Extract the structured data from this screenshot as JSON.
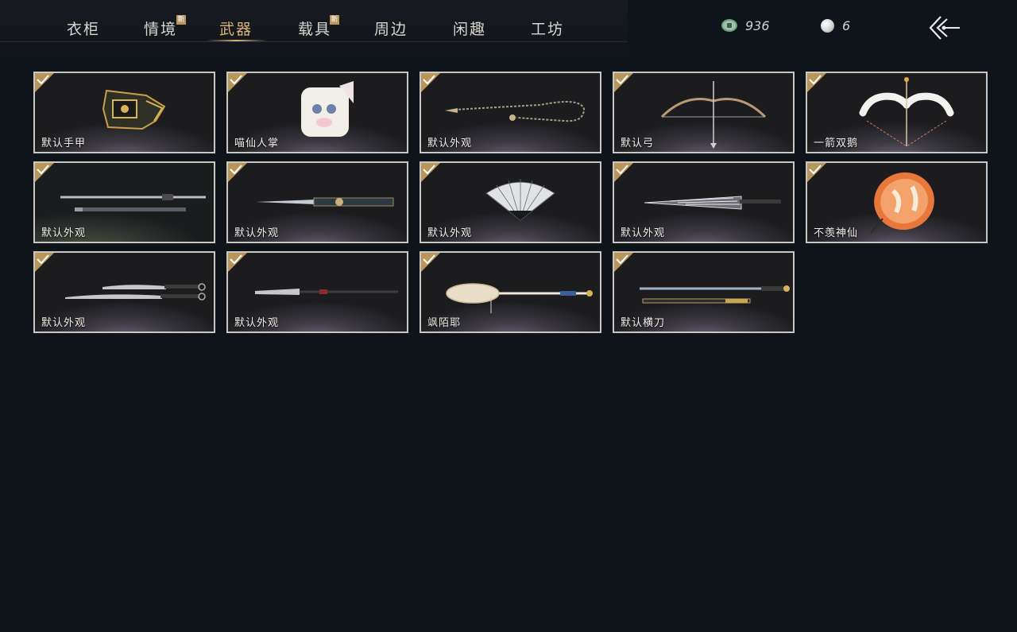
{
  "nav": {
    "tabs": [
      {
        "label": "衣柜",
        "new": false
      },
      {
        "label": "情境",
        "new": true
      },
      {
        "label": "武器",
        "new": false,
        "active": true
      },
      {
        "label": "载具",
        "new": true
      },
      {
        "label": "周边",
        "new": false
      },
      {
        "label": "闲趣",
        "new": false
      },
      {
        "label": "工坊",
        "new": false
      }
    ],
    "new_badge_label": "新"
  },
  "currency": {
    "jade_coin": "936",
    "pearl": "6"
  },
  "items": [
    {
      "name": "默认手甲",
      "owned": true,
      "icon": "gauntlet-icon"
    },
    {
      "name": "喵仙人掌",
      "owned": true,
      "icon": "cat-paw-icon"
    },
    {
      "name": "默认外观",
      "owned": true,
      "icon": "rope-dart-icon"
    },
    {
      "name": "默认弓",
      "owned": true,
      "icon": "bow-icon"
    },
    {
      "name": "一箭双鹅",
      "owned": true,
      "icon": "goose-bow-icon"
    },
    {
      "name": "默认外观",
      "owned": true,
      "icon": "sword-icon"
    },
    {
      "name": "默认外观",
      "owned": true,
      "icon": "ornate-sword-icon"
    },
    {
      "name": "默认外观",
      "owned": true,
      "icon": "fan-icon"
    },
    {
      "name": "默认外观",
      "owned": true,
      "icon": "umbrella-closed-icon"
    },
    {
      "name": "不羡神仙",
      "owned": true,
      "icon": "umbrella-open-icon"
    },
    {
      "name": "默认外观",
      "owned": true,
      "icon": "twin-blades-icon"
    },
    {
      "name": "默认外观",
      "owned": true,
      "icon": "spear-icon"
    },
    {
      "name": "飒陌耶",
      "owned": true,
      "icon": "mirror-staff-icon"
    },
    {
      "name": "默认横刀",
      "owned": true,
      "icon": "hengdao-icon"
    }
  ],
  "colors": {
    "accent_gold": "#d9b47a",
    "check_gold": "#b8955b",
    "card_border": "#c9c7c2",
    "background": "#0f131a"
  }
}
